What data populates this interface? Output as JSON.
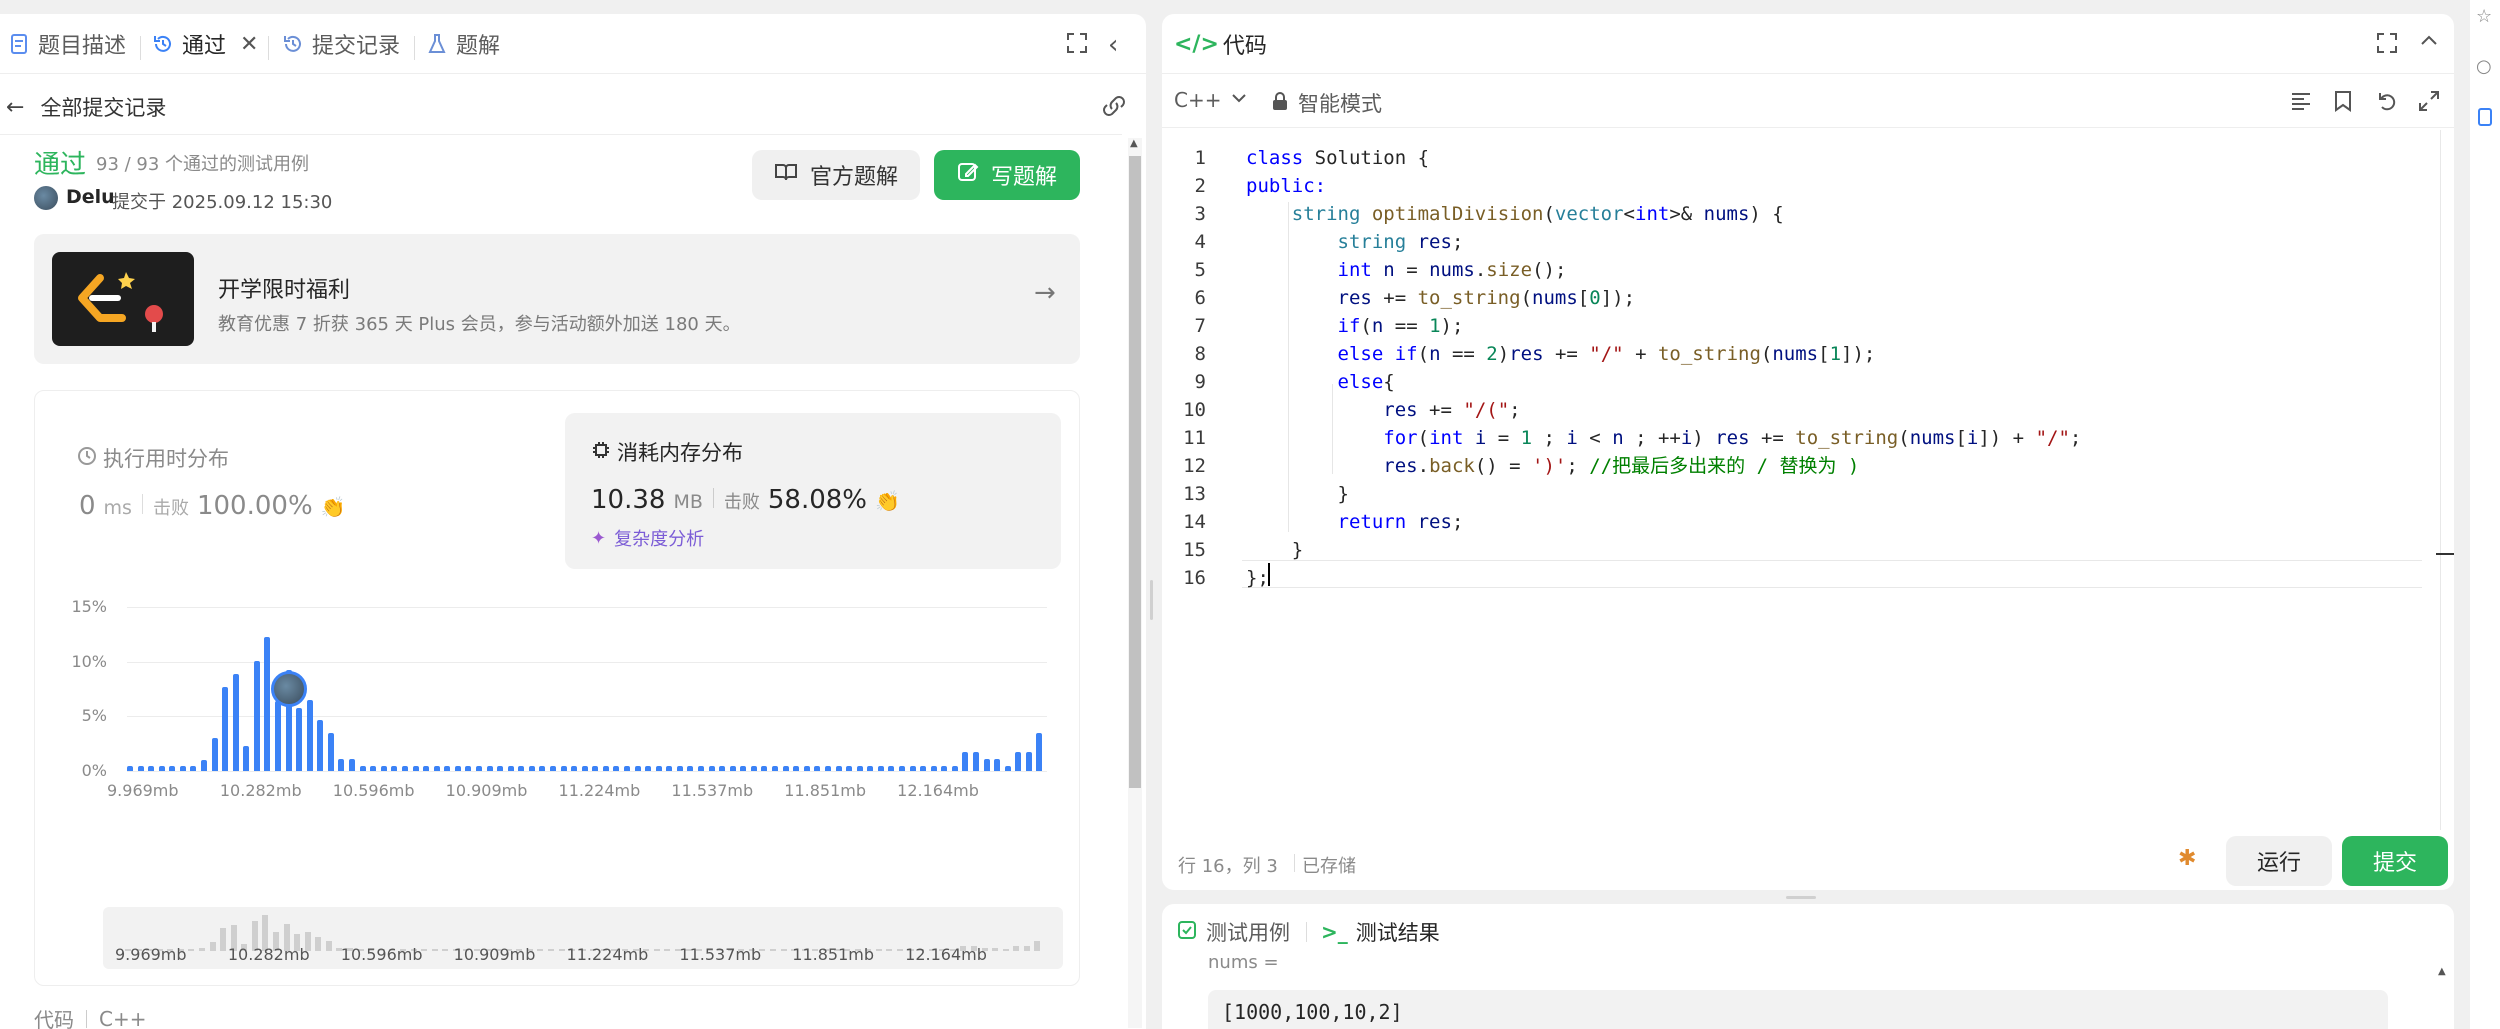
{
  "left_tabs": [
    {
      "label": "题目描述",
      "icon": "description-icon"
    },
    {
      "label": "通过",
      "icon": "history-icon"
    },
    {
      "label": "提交记录",
      "icon": "history-icon"
    },
    {
      "label": "题解",
      "icon": "flask-icon"
    }
  ],
  "back_label": "全部提交记录",
  "result": {
    "status": "通过",
    "cases": "93 / 93 个通过的测试用例",
    "user": "Delu",
    "submitted": "提交于 2025.09.12 15:30"
  },
  "buttons": {
    "official_solution": "官方题解",
    "write_solution": "写题解",
    "run": "运行",
    "submit": "提交"
  },
  "promo": {
    "title": "开学限时福利",
    "desc": "教育优惠 7 折获 365 天 Plus 会员，参与活动额外加送 180 天。"
  },
  "runtime": {
    "title": "执行用时分布",
    "value": "0",
    "unit": "ms",
    "beat_label": "击败",
    "beat": "100.00%"
  },
  "memory": {
    "title": "消耗内存分布",
    "value": "10.38",
    "unit": "MB",
    "beat_label": "击败",
    "beat": "58.08%",
    "complexity": "复杂度分析"
  },
  "chart_data": {
    "type": "bar",
    "yticks": [
      "15%",
      "10%",
      "5%",
      "0%"
    ],
    "ylim": [
      0,
      15
    ],
    "xticks": [
      "9.969mb",
      "10.282mb",
      "10.596mb",
      "10.909mb",
      "11.224mb",
      "11.537mb",
      "11.851mb",
      "12.164mb"
    ],
    "values": [
      0.5,
      0.5,
      0.5,
      0.5,
      0.5,
      0.5,
      0.5,
      1,
      3,
      7.7,
      8.9,
      2.3,
      10.1,
      12.3,
      6.4,
      9.2,
      5.8,
      6.5,
      4.7,
      3.5,
      1.1,
      1.1,
      0.5,
      0.5,
      0.5,
      0.5,
      0.5,
      0.5,
      0.5,
      0.5,
      0.5,
      0.5,
      0.5,
      0.5,
      0.5,
      0.5,
      0.5,
      0.5,
      0.5,
      0.5,
      0.5,
      0.5,
      0.5,
      0.5,
      0.5,
      0.5,
      0.5,
      0.5,
      0.5,
      0.5,
      0.5,
      0.5,
      0.5,
      0.5,
      0.5,
      0.5,
      0.5,
      0.5,
      0.5,
      0.5,
      0.5,
      0.5,
      0.5,
      0.5,
      0.5,
      0.5,
      0.5,
      0.5,
      0.5,
      0.5,
      0.5,
      0.5,
      0.5,
      0.5,
      0.5,
      0.5,
      0.5,
      0.5,
      0.5,
      1.7,
      1.7,
      1.1,
      1.1,
      0.5,
      1.7,
      1.7,
      3.5
    ],
    "mini_xticks": [
      "9.969mb",
      "10.282mb",
      "10.596mb",
      "10.909mb",
      "11.224mb",
      "11.537mb",
      "11.851mb",
      "12.164mb"
    ]
  },
  "bottom_left": {
    "label": "代码",
    "lang": "C++"
  },
  "code_panel": {
    "title": "代码",
    "lang": "C++",
    "mode": "智能模式",
    "status_pos": "行 16，列 3",
    "status_saved": "已存储"
  },
  "code_lines": [
    "class Solution {",
    "public:",
    "    string optimalDivision(vector<int>& nums) {",
    "        string res;",
    "        int n = nums.size();",
    "        res += to_string(nums[0]);",
    "        if(n == 1);",
    "        else if(n == 2)res += \"/\" + to_string(nums[1]);",
    "        else{",
    "            res += \"/(\";",
    "            for(int i = 1 ; i < n ; ++i) res += to_string(nums[i]) + \"/\";",
    "            res.back() = ')'; //把最后多出来的 / 替换为 )",
    "        }",
    "        return res;",
    "    }",
    "};"
  ],
  "test_tabs": {
    "cases": "测试用例",
    "results": "测试结果"
  },
  "testcase": {
    "label": "nums =",
    "value": "[1000,100,10,2]"
  }
}
